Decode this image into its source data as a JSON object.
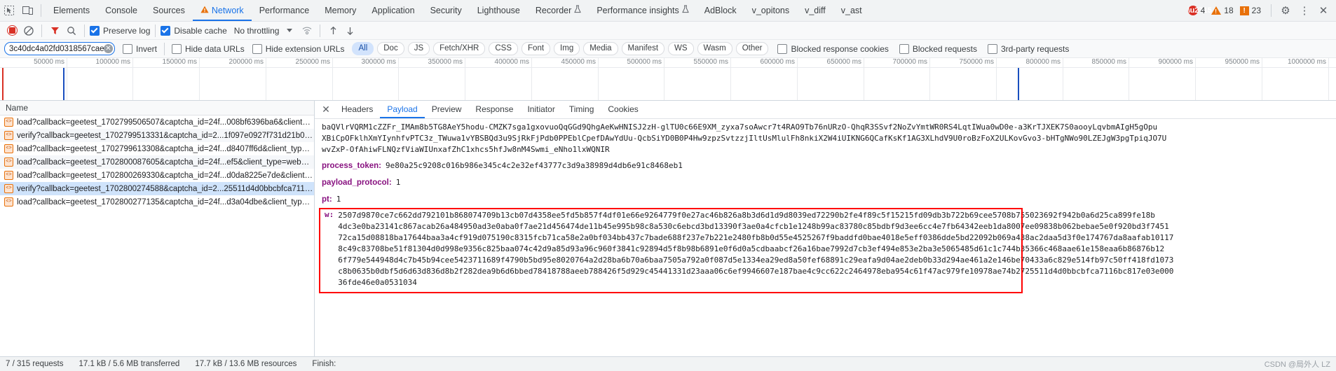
{
  "tabbar": {
    "left_icons": [
      {
        "name": "inspect-element-icon",
        "glyph": "⬚"
      },
      {
        "name": "device-toolbar-icon",
        "glyph": "⎕"
      }
    ],
    "tabs": [
      {
        "label": "Elements",
        "active": false,
        "warn": false,
        "flask": false
      },
      {
        "label": "Console",
        "active": false,
        "warn": false,
        "flask": false
      },
      {
        "label": "Sources",
        "active": false,
        "warn": false,
        "flask": false
      },
      {
        "label": "Network",
        "active": true,
        "warn": true,
        "flask": false
      },
      {
        "label": "Performance",
        "active": false,
        "warn": false,
        "flask": false
      },
      {
        "label": "Memory",
        "active": false,
        "warn": false,
        "flask": false
      },
      {
        "label": "Application",
        "active": false,
        "warn": false,
        "flask": false
      },
      {
        "label": "Security",
        "active": false,
        "warn": false,
        "flask": false
      },
      {
        "label": "Lighthouse",
        "active": false,
        "warn": false,
        "flask": false
      },
      {
        "label": "Recorder",
        "active": false,
        "warn": false,
        "flask": true
      },
      {
        "label": "Performance insights",
        "active": false,
        "warn": false,
        "flask": true
      },
      {
        "label": "AdBlock",
        "active": false,
        "warn": false,
        "flask": false
      },
      {
        "label": "v_opitons",
        "active": false,
        "warn": false,
        "flask": false
      },
      {
        "label": "v_diff",
        "active": false,
        "warn": false,
        "flask": false
      },
      {
        "label": "v_ast",
        "active": false,
        "warn": false,
        "flask": false
      }
    ],
    "counters": {
      "errors": "4",
      "warnings": "18",
      "issues": "23"
    },
    "settings_label": "⚙",
    "more_label": "⋮",
    "close_label": "✕"
  },
  "controls": {
    "record_title": "Stop recording",
    "clear_title": "Clear",
    "filter_title": "Filter",
    "search_title": "Search",
    "preserve_log": {
      "label": "Preserve log",
      "checked": true
    },
    "disable_cache": {
      "label": "Disable cache",
      "checked": true
    },
    "throttling": "No throttling",
    "import_title": "Import HAR",
    "export_title": "Export HAR"
  },
  "filters": {
    "input_value": "3c40dc4a02fd0318567caef5",
    "input_placeholder": "Filter",
    "clear_glyph": "✕",
    "invert": {
      "label": "Invert",
      "checked": false
    },
    "hide_data_urls": {
      "label": "Hide data URLs",
      "checked": false
    },
    "hide_extension_urls": {
      "label": "Hide extension URLs",
      "checked": false
    },
    "types": [
      {
        "label": "All",
        "selected": true
      },
      {
        "label": "Doc",
        "selected": false
      },
      {
        "label": "JS",
        "selected": false
      },
      {
        "label": "Fetch/XHR",
        "selected": false
      },
      {
        "label": "CSS",
        "selected": false
      },
      {
        "label": "Font",
        "selected": false
      },
      {
        "label": "Img",
        "selected": false
      },
      {
        "label": "Media",
        "selected": false
      },
      {
        "label": "Manifest",
        "selected": false
      },
      {
        "label": "WS",
        "selected": false
      },
      {
        "label": "Wasm",
        "selected": false
      },
      {
        "label": "Other",
        "selected": false
      }
    ],
    "blocked_response_cookies": {
      "label": "Blocked response cookies",
      "checked": false
    },
    "blocked_requests": {
      "label": "Blocked requests",
      "checked": false
    },
    "third_party_requests": {
      "label": "3rd-party requests",
      "checked": false
    }
  },
  "overview": {
    "ticks": [
      "50000 ms",
      "100000 ms",
      "150000 ms",
      "200000 ms",
      "250000 ms",
      "300000 ms",
      "350000 ms",
      "400000 ms",
      "450000 ms",
      "500000 ms",
      "550000 ms",
      "600000 ms",
      "650000 ms",
      "700000 ms",
      "750000 ms",
      "800000 ms",
      "850000 ms",
      "900000 ms",
      "950000 ms",
      "1000000 ms"
    ],
    "markers": [
      {
        "x_pct": 0.15,
        "color": "#d93025"
      },
      {
        "x_pct": 4.7,
        "color": "#1a4fbf"
      },
      {
        "x_pct": 76.2,
        "color": "#1a4fbf"
      }
    ]
  },
  "request_list": {
    "column_header": "Name",
    "rows": [
      {
        "name": "load?callback=geetest_1702799506507&captcha_id=24f...008bf6396ba6&client_typ...",
        "selected": false
      },
      {
        "name": "verify?callback=geetest_1702799513331&captcha_id=2...1f097e0927f731d21b094fa...",
        "selected": false
      },
      {
        "name": "load?callback=geetest_1702799613308&captcha_id=24f...d8407ff6d&client_type=w...",
        "selected": false
      },
      {
        "name": "load?callback=geetest_1702800087605&captcha_id=24f...ef5&client_type=web&ris...",
        "selected": false
      },
      {
        "name": "load?callback=geetest_1702800269330&captcha_id=24f...d0da8225e7de&client_ty...",
        "selected": false
      },
      {
        "name": "verify?callback=geetest_1702800274588&captcha_id=2...25511d4d0bbcbfca7116bc...",
        "selected": true
      },
      {
        "name": "load?callback=geetest_1702800277135&captcha_id=24f...d3a04dbe&client_type=...",
        "selected": false
      }
    ]
  },
  "detail": {
    "close_glyph": "✕",
    "tabs": [
      {
        "label": "Headers",
        "active": false
      },
      {
        "label": "Payload",
        "active": true
      },
      {
        "label": "Preview",
        "active": false
      },
      {
        "label": "Response",
        "active": false
      },
      {
        "label": "Initiator",
        "active": false
      },
      {
        "label": "Timing",
        "active": false
      },
      {
        "label": "Cookies",
        "active": false
      }
    ],
    "top_blob_lines": [
      "baQVlrVQRM1cZZFr_IMAm8b5TG8AeY5hodu-CMZK7sga1gxovuoQqGGd9QhgAeKwHNISJ2zH-glTU0c66E9XM_zyxa7soAwcr7t4RAO9Tb76nURzO-QhqR3SSvf2NoZvYmtWR0RS4LqtIWua0wD0e-a3KrTJXEK7S0aooyLqvbmAIgH5gOpu",
      "XBiCpOFklhXmYIynhfvPTC3z_TWuwa1vYBSBQd3u9SjRkFjPdb0PPEblCpefDAwYdUu-QcbSiYD0B0P4Hw9zpzSvtzzjIltUsMlulFh8nkiX2W4iUIKNG6QCafKsKf1AG3XLhdV9U0roBzFoX2ULKovGvo3-bHTgNWo90LZEJgW3pgTpiqJO7U",
      "wvZxP-OfAhiwFLNQzfViaWIUnxafZhC1xhcs5hfJw8nM4Swmi_eNho1lxWQNIR"
    ],
    "fields": [
      {
        "key": "process_token:",
        "value": "9e80a25c9208c016b986e345c4c2e32ef43777c3d9a38989d4db6e91c8468eb1"
      },
      {
        "key": "payload_protocol:",
        "value": "1"
      },
      {
        "key": "pt:",
        "value": "1"
      }
    ],
    "w_field_key": "w:",
    "w_value_lines": [
      "2507d9870ce7c662dd792101b868074709b13cb07d4358ee5fd5b857f4df01e66e9264779f0e27ac46b826a8b3d6d1d9d8039ed72290b2fe4f89c5f15215fd09db3b722b69cee5708b755023692f942b0a6d25ca899fe18b",
      "4dc3e0ba23141c867acab26a484950ad3e0aba0f7ae21d456474de11b45e995b98c8a530c6ebcd3bd13390f3ae0a4cfcb1e1248b99ac83780c85bdbf9d3ee6cc4e7fb64342eeb1da8007ee09838b062bebae5e0f920bd3f7451",
      "72ca15d08818ba17644baa3a4cf919d075190c8315fcb71ca58e2a0bf034bb437c7bade688f237e7b221e2480fb8b0d55e4525267f9baddfd0bae4018e5eff0386dde5bd22092b069a438ac2daa5d3f0e174767da8aafab10117",
      "8c49c83708be51f81304d0d998e9356c825baa074c42d9a85d93a96c960f3841c92894d5f8b98b6891e0f6d0a5cdbaabcf26a16bae7992d7cb3ef494e853e2ba3e5065485d61c1c744b35366c468aae61e158eaa6b86876b12",
      "6f779e544948d4c7b45b94cee5423711689f4790b5bd95e8020764a2d28ba6b70a6baa7505a792a0f087d5e1334ea29ed8a50fef68891c29eafa9d04ae2deb0b33d294ae461a2e146be70433a6c829e514fb97c50ff418fd1073",
      "c8b0635b0dbf5d6d63d836d8b2f282dea9b6d6bbed78418788aeeb788426f5d929c45441331d23aaa06c6ef9946607e187bae4c9cc622c2464978eba954c61f47ac979fe10978ae74b2725511d4d0bbcbfca7116bc817e03e000",
      "36fde46e0a0531034"
    ]
  },
  "statusbar": {
    "requests": "7 / 315 requests",
    "transferred": "17.1 kB / 5.6 MB transferred",
    "resources": "17.7 kB / 13.6 MB resources",
    "finish": "Finish:"
  },
  "watermark": "CSDN @局外人 LZ",
  "colors": {
    "accent": "#1a73e8",
    "error": "#d93025",
    "warn": "#e8710a",
    "highlight_box": "#ff0000",
    "selection": "#cfe3fb"
  }
}
